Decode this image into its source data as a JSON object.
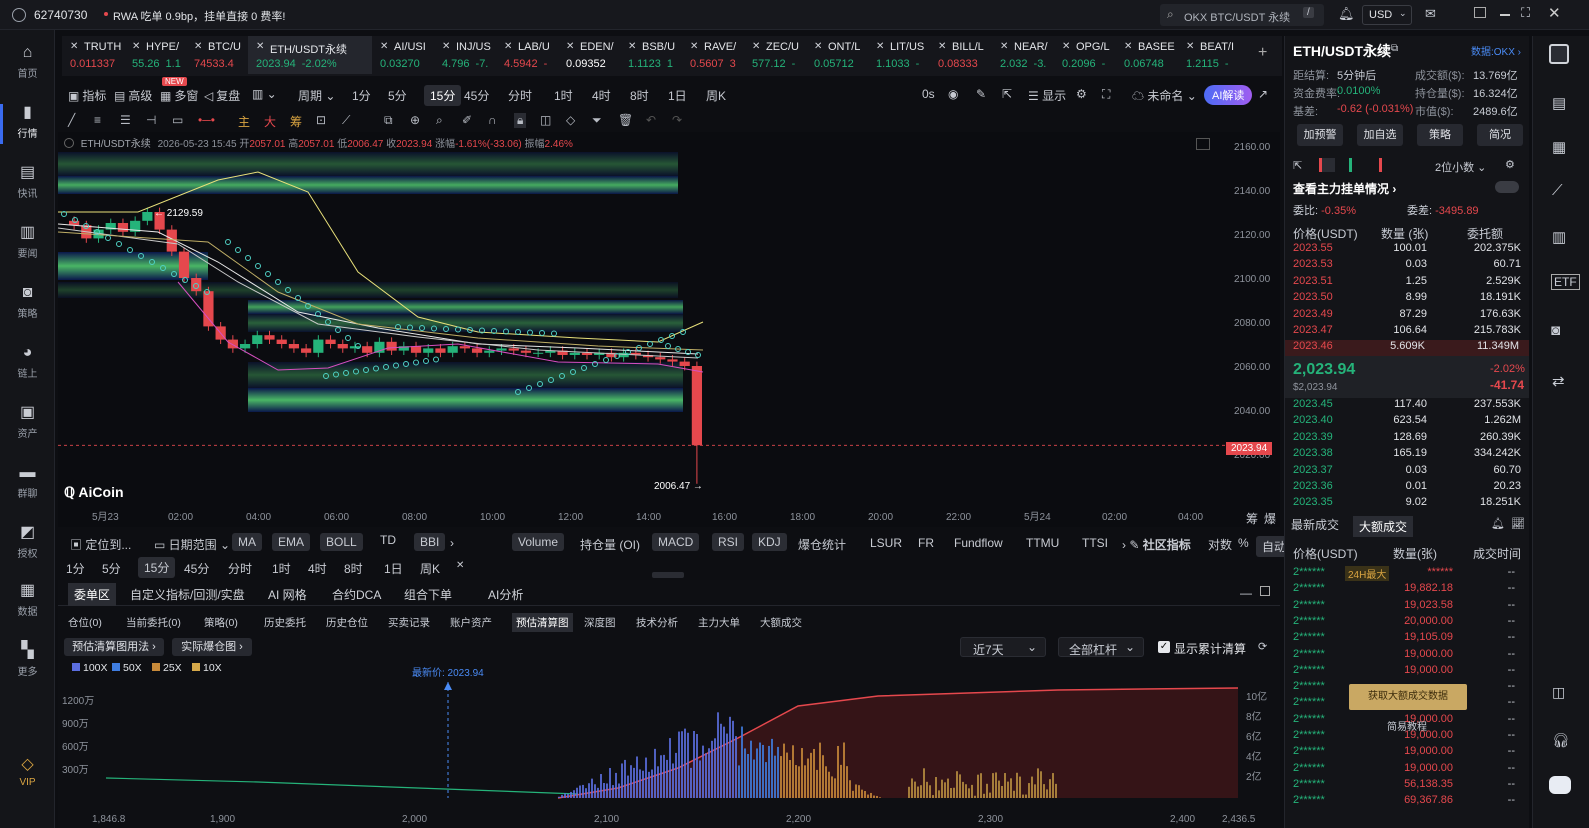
{
  "topbar": {
    "user_id": "62740730",
    "notice": "RWA 吃单 0.9bp，挂单直接 0 费率!",
    "search_placeholder": "OKX BTC/USDT 永续",
    "search_key": "/",
    "currency": "USD"
  },
  "leftnav": [
    {
      "label": "首页",
      "icon": "home-icon"
    },
    {
      "label": "行情",
      "icon": "market-chart-icon"
    },
    {
      "label": "快讯",
      "icon": "flash-news-icon"
    },
    {
      "label": "要闻",
      "icon": "news-icon"
    },
    {
      "label": "策略",
      "icon": "robot-icon"
    },
    {
      "label": "链上",
      "icon": "onchain-icon"
    },
    {
      "label": "资产",
      "icon": "wallet-icon"
    },
    {
      "label": "群聊",
      "icon": "chat-icon"
    },
    {
      "label": "授权",
      "icon": "authorize-icon"
    },
    {
      "label": "数据",
      "icon": "data-icon"
    },
    {
      "label": "更多",
      "icon": "more-grid-icon"
    },
    {
      "label": "VIP",
      "icon": "vip-diamond-icon"
    }
  ],
  "tabs": [
    {
      "name": "TRUTH",
      "price": "0.011337",
      "change": "",
      "color": "#e5484d"
    },
    {
      "name": "HYPE/",
      "price": "55.26",
      "change": "1.1",
      "color": "#25b37a",
      "badge": "NEW"
    },
    {
      "name": "BTC/U",
      "price": "74533.4",
      "change": "",
      "color": "#e5484d"
    },
    {
      "name": "ETH/USDT永续",
      "price": "2023.94",
      "change": "-2.02%",
      "color": "#25b37a",
      "active": true
    },
    {
      "name": "AI/USI",
      "price": "0.03270",
      "change": "",
      "color": "#25b37a"
    },
    {
      "name": "INJ/US",
      "price": "4.796",
      "change": "-7.",
      "color": "#25b37a"
    },
    {
      "name": "LAB/U",
      "price": "4.5942",
      "change": "-",
      "color": "#e5484d"
    },
    {
      "name": "EDEN/",
      "price": "0.09352",
      "change": "",
      "color": "#ffffff"
    },
    {
      "name": "BSB/U",
      "price": "1.1123",
      "change": "1",
      "color": "#25b37a"
    },
    {
      "name": "RAVE/",
      "price": "0.5607",
      "change": "3",
      "color": "#e5484d"
    },
    {
      "name": "ZEC/U",
      "price": "577.12",
      "change": "-",
      "color": "#25b37a"
    },
    {
      "name": "ONT/L",
      "price": "0.05712",
      "change": "",
      "color": "#25b37a"
    },
    {
      "name": "LIT/US",
      "price": "1.1033",
      "change": "-",
      "color": "#25b37a"
    },
    {
      "name": "BILL/L",
      "price": "0.08333",
      "change": "",
      "color": "#e5484d"
    },
    {
      "name": "NEAR/",
      "price": "2.032",
      "change": "-3.",
      "color": "#25b37a"
    },
    {
      "name": "OPG/L",
      "price": "0.2096",
      "change": "-",
      "color": "#25b37a"
    },
    {
      "name": "BASEE",
      "price": "0.06748",
      "change": "",
      "color": "#25b37a"
    },
    {
      "name": "BEAT/I",
      "price": "1.2115",
      "change": "-",
      "color": "#25b37a"
    }
  ],
  "toolbar1": {
    "indicators": "指标",
    "advanced": "高级",
    "multi": "多窗",
    "replay": "复盘",
    "period": "周期",
    "intervals": [
      "1分",
      "5分",
      "15分",
      "45分",
      "分时",
      "1时",
      "4时",
      "8时",
      "1日",
      "周K"
    ],
    "active_interval": "15分",
    "countdown": "0s",
    "display": "显示",
    "unnamed": "未命名",
    "ai": "AI解读"
  },
  "toolbar2": {
    "labels": [
      "主",
      "大",
      "筹"
    ]
  },
  "chart_info": {
    "symbol": "ETH/USDT永续",
    "datetime": "2026-05-23 15:45",
    "open_label": "开",
    "open": "2057.01",
    "high_label": "高",
    "high": "2057.01",
    "low_label": "低",
    "low": "2006.47",
    "close_label": "收",
    "close": "2023.94",
    "change_label": "涨幅",
    "change": "-1.61%(-33.06)",
    "amp_label": "振幅",
    "amp": "2.46%",
    "hi_marker": "2129.59",
    "lo_marker": "2006.47",
    "logo": "AiCoin",
    "last_price_tag": "2023.94"
  },
  "chart_data": {
    "type": "candlestick",
    "yticks": [
      "2160.00",
      "2140.00",
      "2120.00",
      "2100.00",
      "2080.00",
      "2060.00",
      "2040.00",
      "2020.00"
    ],
    "ylim": [
      2020,
      2160
    ],
    "xticks": [
      "5月23",
      "02:00",
      "04:00",
      "06:00",
      "08:00",
      "10:00",
      "12:00",
      "14:00",
      "16:00",
      "18:00",
      "20:00",
      "22:00",
      "5月24",
      "02:00",
      "04:00"
    ],
    "close": [
      2124,
      2118,
      2122,
      2125,
      2121,
      2126,
      2130,
      2122,
      2112,
      2100,
      2094,
      2078,
      2072,
      2068,
      2070,
      2074,
      2072,
      2070,
      2068,
      2066,
      2072,
      2070,
      2068,
      2069,
      2066,
      2071,
      2067,
      2069,
      2066,
      2068,
      2066,
      2069,
      2068,
      2066,
      2067,
      2068,
      2067,
      2066,
      2066,
      2067,
      2065,
      2066,
      2065,
      2066,
      2064,
      2066,
      2065,
      2064,
      2063,
      2062,
      2060,
      2024
    ]
  },
  "chart_corner_labels": {
    "left": "筹",
    "right": "爆"
  },
  "ind_bar": {
    "locate": "定位到...",
    "range": "日期范围",
    "main": [
      "MA",
      "EMA",
      "BOLL",
      "TD",
      "BBI"
    ],
    "sub": [
      "Volume",
      "持仓量 (OI)",
      "MACD",
      "RSI",
      "KDJ",
      "爆仓统计",
      "LSUR",
      "FR",
      "Fundflow",
      "TTMU",
      "TTSI"
    ],
    "community": "社区指标",
    "log": "对数",
    "pct": "%",
    "auto": "自动",
    "intervals": [
      "1分",
      "5分",
      "15分",
      "45分",
      "分时",
      "1时",
      "4时",
      "8时",
      "1日",
      "周K"
    ],
    "active_interval": "15分"
  },
  "bottom": {
    "tabs1": [
      "委单区",
      "自定义指标/回测/实盘",
      "AI 网格",
      "合约DCA",
      "组合下单",
      "AI分析"
    ],
    "tabs2": [
      "仓位(0)",
      "当前委托(0)",
      "策略(0)",
      "历史委托",
      "历史仓位",
      "买卖记录",
      "账户资产",
      "预估清算图",
      "深度图",
      "技术分析",
      "主力大单",
      "大额成交"
    ],
    "active_tab2": "预估清算图",
    "btn1": "预估清算图用法",
    "btn2": "实际爆仓图",
    "range": "近7天",
    "leverage": "全部杠杆",
    "show_cum": "显示累计清算",
    "legend": [
      {
        "label": "100X",
        "color": "#5b6ee0"
      },
      {
        "label": "50X",
        "color": "#3f7de0"
      },
      {
        "label": "25X",
        "color": "#c88a3a"
      },
      {
        "label": "10X",
        "color": "#d6a94a"
      }
    ],
    "latest_label": "最新价: 2023.94",
    "yleft": [
      "1200万",
      "900万",
      "600万",
      "300万"
    ],
    "yright": [
      "10亿",
      "8亿",
      "6亿",
      "4亿",
      "2亿"
    ],
    "xticks": [
      "1,846.8",
      "1,900",
      "2,000",
      "2,100",
      "2,200",
      "2,300",
      "2,400",
      "2,436.5"
    ]
  },
  "right": {
    "title": "ETH/USDT永续",
    "exchange": "数据:OKX",
    "stats": [
      {
        "k": "距结算:",
        "v": "5分钟后",
        "k2": "成交额($):",
        "v2": "13.769亿"
      },
      {
        "k": "资金费率:",
        "v": "0.0100%",
        "k2": "持仓量($):",
        "v2": "16.324亿"
      },
      {
        "k": "基差:",
        "v": "-0.62 (-0.031%)",
        "k2": "市值($):",
        "v2": "2489.6亿"
      }
    ],
    "buttons": [
      "加预警",
      "加自选",
      "策略",
      "简况"
    ],
    "precision": "2位小数",
    "main_orders": "查看主力挂单情况",
    "ratio_label": "委比:",
    "ratio": "-0.35%",
    "diff_label": "委差:",
    "diff": "-3495.89",
    "ob_headers": [
      "价格(USDT)",
      "数量 (张)",
      "委托额"
    ],
    "asks": [
      [
        "2023.55",
        "100.01",
        "202.375K"
      ],
      [
        "2023.53",
        "0.03",
        "60.71"
      ],
      [
        "2023.51",
        "1.25",
        "2.529K"
      ],
      [
        "2023.50",
        "8.99",
        "18.191K"
      ],
      [
        "2023.49",
        "87.29",
        "176.63K"
      ],
      [
        "2023.47",
        "106.64",
        "215.783K"
      ],
      [
        "2023.46",
        "5.609K",
        "11.349M"
      ]
    ],
    "last": "2,023.94",
    "last_usd": "$2,023.94",
    "last_pct": "-2.02%",
    "last_chg": "-41.74",
    "bids": [
      [
        "2023.45",
        "117.40",
        "237.553K"
      ],
      [
        "2023.40",
        "623.54",
        "1.262M"
      ],
      [
        "2023.39",
        "128.69",
        "260.39K"
      ],
      [
        "2023.38",
        "165.19",
        "334.242K"
      ],
      [
        "2023.37",
        "0.03",
        "60.70"
      ],
      [
        "2023.36",
        "0.01",
        "20.23"
      ],
      [
        "2023.35",
        "9.02",
        "18.251K"
      ]
    ],
    "trade_tabs": [
      "最新成交",
      "大额成交"
    ],
    "trade_headers": [
      "价格(USDT)",
      "数量(张)",
      "成交时间"
    ],
    "trades": [
      [
        "2******",
        "******",
        "--",
        "24H最大"
      ],
      [
        "2******",
        "19,882.18",
        "--",
        ""
      ],
      [
        "2******",
        "19,023.58",
        "--",
        ""
      ],
      [
        "2******",
        "20,000.00",
        "--",
        ""
      ],
      [
        "2******",
        "19,105.09",
        "--",
        ""
      ],
      [
        "2******",
        "19,000.00",
        "--",
        ""
      ],
      [
        "2******",
        "19,000.00",
        "--",
        ""
      ],
      [
        "2******",
        "",
        "--",
        ""
      ],
      [
        "2******",
        "",
        "--",
        ""
      ],
      [
        "2******",
        "19,000.00",
        "--",
        ""
      ],
      [
        "2******",
        "19,000.00",
        "--",
        ""
      ],
      [
        "2******",
        "19,000.00",
        "--",
        ""
      ],
      [
        "2******",
        "19,000.00",
        "--",
        ""
      ],
      [
        "2******",
        "56,138.35",
        "--",
        ""
      ],
      [
        "2******",
        "69,367.86",
        "--",
        ""
      ]
    ],
    "overlay_btn": "获取大额成交数据",
    "overlay_sub": "简易教程"
  }
}
